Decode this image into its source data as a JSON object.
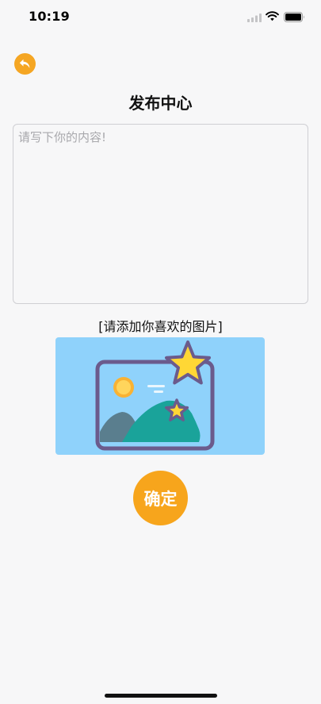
{
  "status_bar": {
    "time": "10:19"
  },
  "header": {
    "title": "发布中心",
    "back_icon": "back-arrow-icon"
  },
  "editor": {
    "placeholder": "请写下你的内容!",
    "value": ""
  },
  "image_section": {
    "hint": "[请添加你喜欢的图片]",
    "placeholder_icon": "image-placeholder-icon"
  },
  "actions": {
    "confirm_label": "确定"
  },
  "colors": {
    "accent": "#f7a51c",
    "image_bg": "#8fd2fb",
    "frame": "#6b5b8c",
    "star": "#ffd735",
    "sun": "#f9b233",
    "mountain_dark": "#5a7e8e",
    "mountain_teal": "#1aa39a"
  }
}
